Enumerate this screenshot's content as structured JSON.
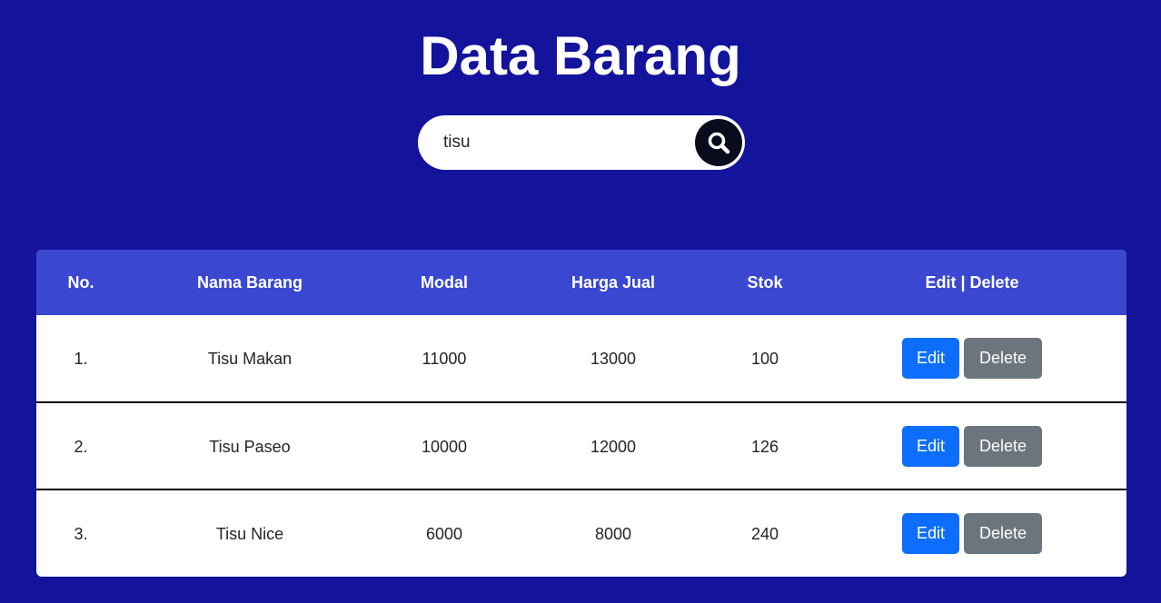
{
  "page": {
    "title": "Data Barang"
  },
  "search": {
    "value": "tisu",
    "icon": "search-icon"
  },
  "table": {
    "headers": {
      "no": "No.",
      "nama": "Nama Barang",
      "modal": "Modal",
      "harga_jual": "Harga Jual",
      "stok": "Stok",
      "aksi": "Edit | Delete"
    },
    "rows": [
      {
        "no": "1.",
        "nama": "Tisu Makan",
        "modal": "11000",
        "harga_jual": "13000",
        "stok": "100",
        "edit_label": "Edit",
        "delete_label": "Delete"
      },
      {
        "no": "2.",
        "nama": "Tisu Paseo",
        "modal": "10000",
        "harga_jual": "12000",
        "stok": "126",
        "edit_label": "Edit",
        "delete_label": "Delete"
      },
      {
        "no": "3.",
        "nama": "Tisu Nice",
        "modal": "6000",
        "harga_jual": "8000",
        "stok": "240",
        "edit_label": "Edit",
        "delete_label": "Delete"
      }
    ]
  },
  "colors": {
    "background": "#13139b",
    "table_header": "#3a47d0",
    "edit_button": "#0d6efd",
    "delete_button": "#6c757d",
    "search_button": "#0b0b1e"
  }
}
